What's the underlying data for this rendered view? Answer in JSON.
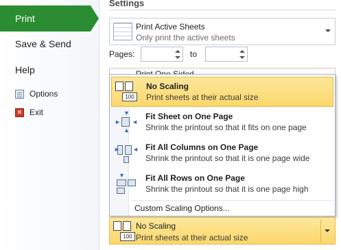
{
  "nav": {
    "print": "Print",
    "save_send": "Save & Send",
    "help": "Help",
    "options": "Options",
    "exit": "Exit"
  },
  "settings": {
    "title": "Settings",
    "print_what": {
      "title": "Print Active Sheets",
      "subtitle": "Only print the active sheets"
    },
    "pages": {
      "label": "Pages:",
      "from_value": "",
      "to_label": "to",
      "to_value": ""
    },
    "sides_partial": "Print One Sided",
    "scaling_menu": {
      "options": [
        {
          "title": "No Scaling",
          "subtitle": "Print sheets at their actual size",
          "selected": true,
          "icon": "no-scaling-icon"
        },
        {
          "title": "Fit Sheet on One Page",
          "subtitle": "Shrink the printout so that it fits on one page",
          "selected": false,
          "icon": "fit-sheet-icon"
        },
        {
          "title": "Fit All Columns on One Page",
          "subtitle": "Shrink the printout so that it is one page wide",
          "selected": false,
          "icon": "fit-columns-icon"
        },
        {
          "title": "Fit All Rows on One Page",
          "subtitle": "Shrink the printout so that it is one page high",
          "selected": false,
          "icon": "fit-rows-icon"
        }
      ],
      "custom": "Custom Scaling Options..."
    },
    "scaling_current": {
      "title": "No Scaling",
      "subtitle": "Print sheets at their actual size"
    },
    "icon_text": "100"
  },
  "colors": {
    "accent_green": "#2a8d32",
    "highlight": "#fbd86c"
  }
}
